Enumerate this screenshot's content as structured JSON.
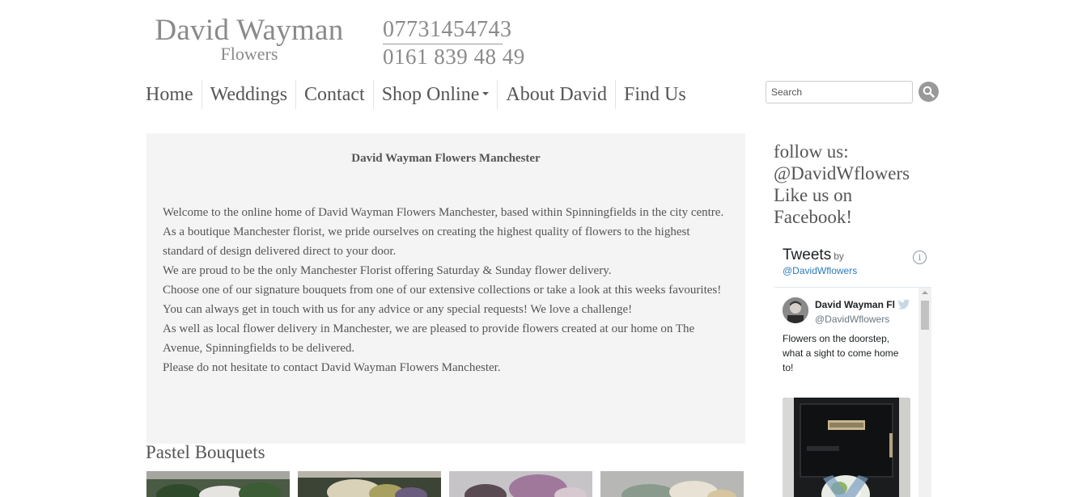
{
  "brand": {
    "name": "David Wayman",
    "sub": "Flowers"
  },
  "phones": {
    "mobile": "07731454743",
    "landline": "0161 839 48 49"
  },
  "nav": {
    "items": [
      {
        "label": "Home"
      },
      {
        "label": "Weddings"
      },
      {
        "label": "Contact"
      },
      {
        "label": "Shop Online"
      },
      {
        "label": "About David"
      },
      {
        "label": "Find Us"
      }
    ]
  },
  "search": {
    "placeholder": "Search"
  },
  "main": {
    "title": "David Wayman Flowers Manchester",
    "paragraphs": [
      "Welcome to the online home of David Wayman Flowers Manchester, based within Spinningfields in the city centre.",
      "As a boutique Manchester florist, we pride ourselves on creating the highest quality of flowers to the highest standard of design delivered direct to your door.",
      "We are proud to be the only Manchester Florist offering Saturday & Sunday flower delivery.",
      "Choose one of our signature bouquets from one of our extensive collections or take a look at this weeks favourites!",
      "You can always get in touch with us for any advice or any special requests! We love a challenge!",
      "As well as local flower delivery in Manchester, we are pleased to provide flowers created at our home on The Avenue, Spinningfields to be delivered.",
      "Please do not hesitate to contact David Wayman Flowers Manchester."
    ]
  },
  "section": {
    "heading": "Pastel Bouquets"
  },
  "sidebar": {
    "follow_lines": [
      "follow us:",
      "@DavidWflowers",
      "Like us on",
      "Facebook!"
    ]
  },
  "twitter": {
    "title": "Tweets",
    "by": "by",
    "handle": "@DavidWflowers",
    "info": "i",
    "tweet": {
      "name": "David Wayman Fl",
      "user": "@DavidWflowers",
      "text": "Flowers on the doorstep, what a sight to come home to!"
    }
  },
  "colors": {
    "text": "#555555",
    "panel": "#f4f4f4",
    "twitter_link": "#2b7bb9"
  }
}
